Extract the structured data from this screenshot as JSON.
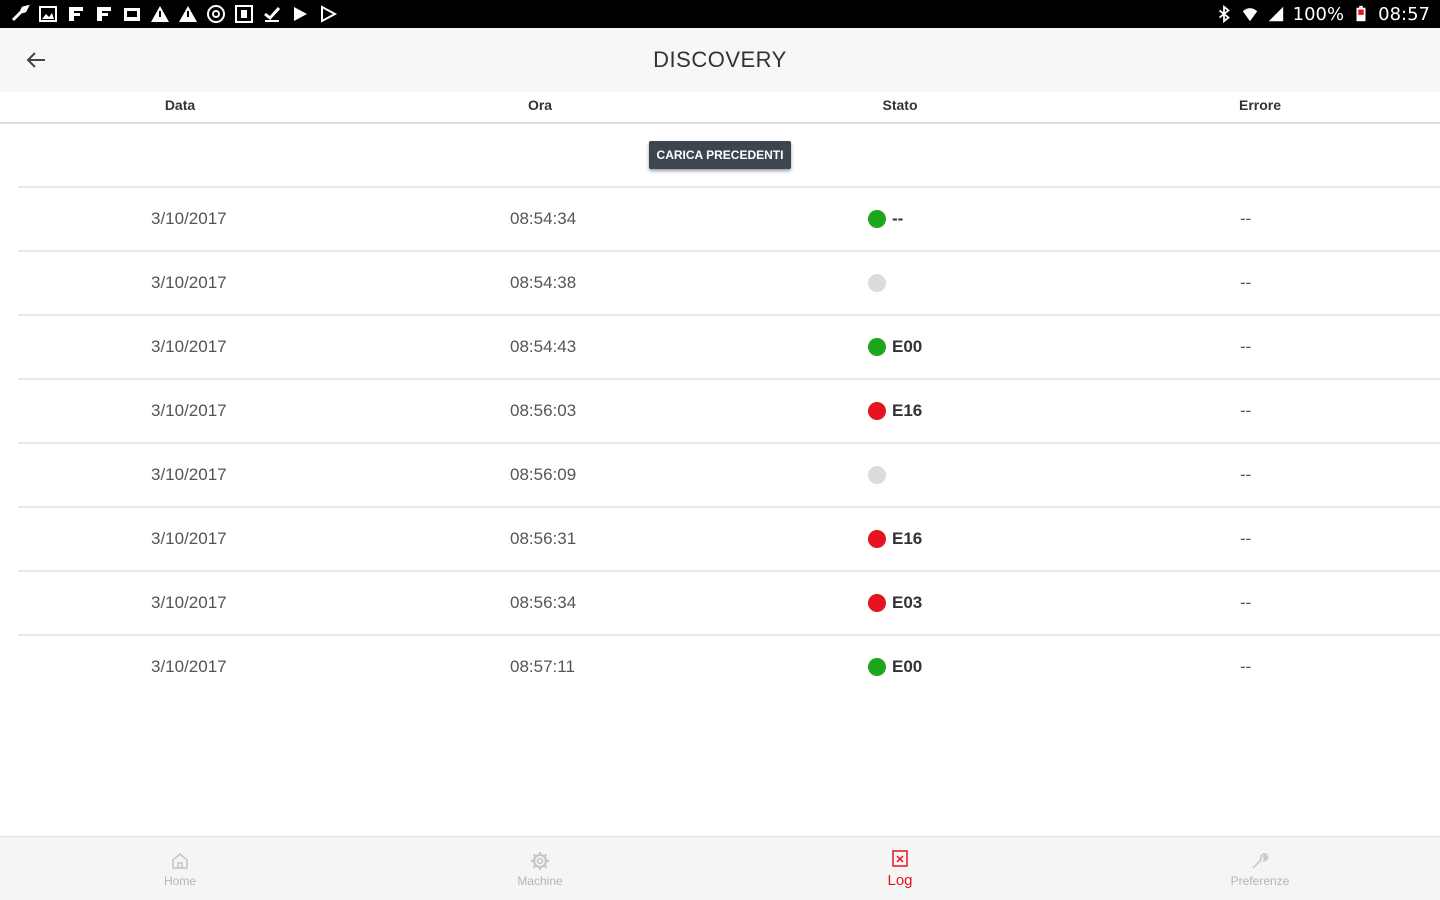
{
  "status_bar": {
    "battery": "100%",
    "time": "08:57",
    "left_icons": [
      "wrench-icon",
      "image-icon",
      "f-icon",
      "f-icon",
      "gallery-icon",
      "warning-icon",
      "warning-icon",
      "at-icon",
      "calendar-icon",
      "check-icon",
      "play-icon",
      "play-icon"
    ]
  },
  "header": {
    "title": "DISCOVERY",
    "back_icon": "arrow-left-icon"
  },
  "table": {
    "columns": [
      "Data",
      "Ora",
      "Stato",
      "Errore"
    ],
    "load_button": "CARICA PRECEDENTI",
    "rows": [
      {
        "date": "3/10/2017",
        "time": "08:54:34",
        "status_color": "green",
        "status_code": "--",
        "error": "--"
      },
      {
        "date": "3/10/2017",
        "time": "08:54:38",
        "status_color": "grey",
        "status_code": "",
        "error": "--"
      },
      {
        "date": "3/10/2017",
        "time": "08:54:43",
        "status_color": "green",
        "status_code": "E00",
        "error": "--"
      },
      {
        "date": "3/10/2017",
        "time": "08:56:03",
        "status_color": "red",
        "status_code": "E16",
        "error": "--"
      },
      {
        "date": "3/10/2017",
        "time": "08:56:09",
        "status_color": "grey",
        "status_code": "",
        "error": "--"
      },
      {
        "date": "3/10/2017",
        "time": "08:56:31",
        "status_color": "red",
        "status_code": "E16",
        "error": "--"
      },
      {
        "date": "3/10/2017",
        "time": "08:56:34",
        "status_color": "red",
        "status_code": "E03",
        "error": "--"
      },
      {
        "date": "3/10/2017",
        "time": "08:57:11",
        "status_color": "green",
        "status_code": "E00",
        "error": "--"
      }
    ]
  },
  "bottom_nav": {
    "items": [
      {
        "label": "Home",
        "icon": "home-icon",
        "active": false
      },
      {
        "label": "Machine",
        "icon": "gear-icon",
        "active": false
      },
      {
        "label": "Log",
        "icon": "log-icon",
        "active": true
      },
      {
        "label": "Preferenze",
        "icon": "wrench-icon",
        "active": false
      }
    ]
  },
  "colors": {
    "accent": "#e5141e",
    "ok": "#1ea51e",
    "idle": "#dcdcdc",
    "button": "#3d464f"
  }
}
